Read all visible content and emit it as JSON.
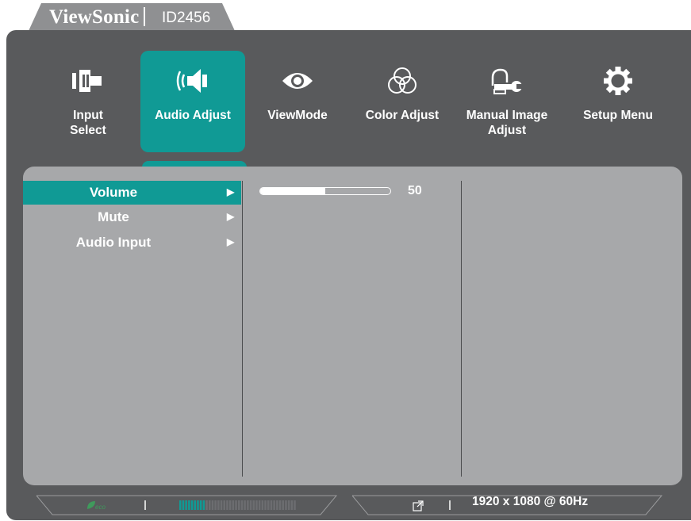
{
  "brand": {
    "name": "ViewSonic",
    "model": "ID2456"
  },
  "menu": [
    {
      "label": "Input\nSelect",
      "icon": "input-select-icon",
      "active": false
    },
    {
      "label": "Audio Adjust",
      "icon": "audio-adjust-icon",
      "active": true
    },
    {
      "label": "ViewMode",
      "icon": "eye-icon",
      "active": false
    },
    {
      "label": "Color Adjust",
      "icon": "color-circles-icon",
      "active": false
    },
    {
      "label": "Manual Image\nAdjust",
      "icon": "hand-wrench-icon",
      "active": false
    },
    {
      "label": "Setup Menu",
      "icon": "gear-icon",
      "active": false
    }
  ],
  "submenu": [
    {
      "label": "Volume",
      "selected": true
    },
    {
      "label": "Mute",
      "selected": false
    },
    {
      "label": "Audio Input",
      "selected": false
    }
  ],
  "volume": {
    "value": "50",
    "level": 0.5
  },
  "status": {
    "eco_icon": "eco-leaf-icon",
    "brightness_level": 0.22,
    "resolution": "1920 x 1080 @ 60Hz",
    "source_icon": "input-source-icon"
  },
  "colors": {
    "accent": "#109a95",
    "frame": "#595a5c",
    "panel": "#a7a8aa"
  }
}
